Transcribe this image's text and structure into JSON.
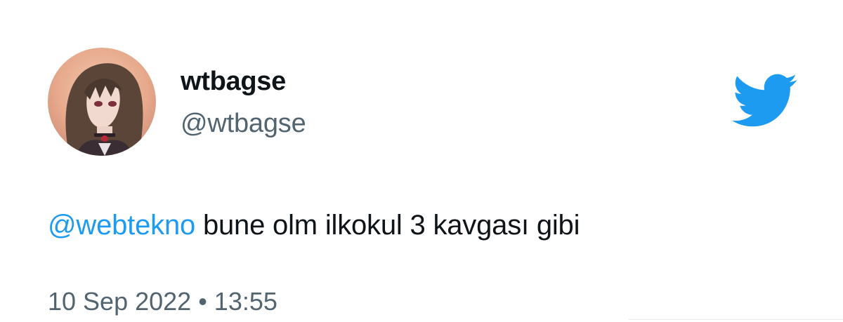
{
  "user": {
    "display_name": "wtbagse",
    "handle": "@wtbagse",
    "avatar_icon": "anime-character-avatar"
  },
  "tweet": {
    "mention": "@webtekno",
    "text": " bune olm ilkokul 3 kavgası gibi",
    "date": "10 Sep 2022",
    "separator": " • ",
    "time": "13:55"
  },
  "brand": {
    "logo_icon": "twitter-bird-icon",
    "accent_color": "#1d9bf0",
    "text_color": "#0f1419",
    "secondary_text_color": "#536471"
  }
}
